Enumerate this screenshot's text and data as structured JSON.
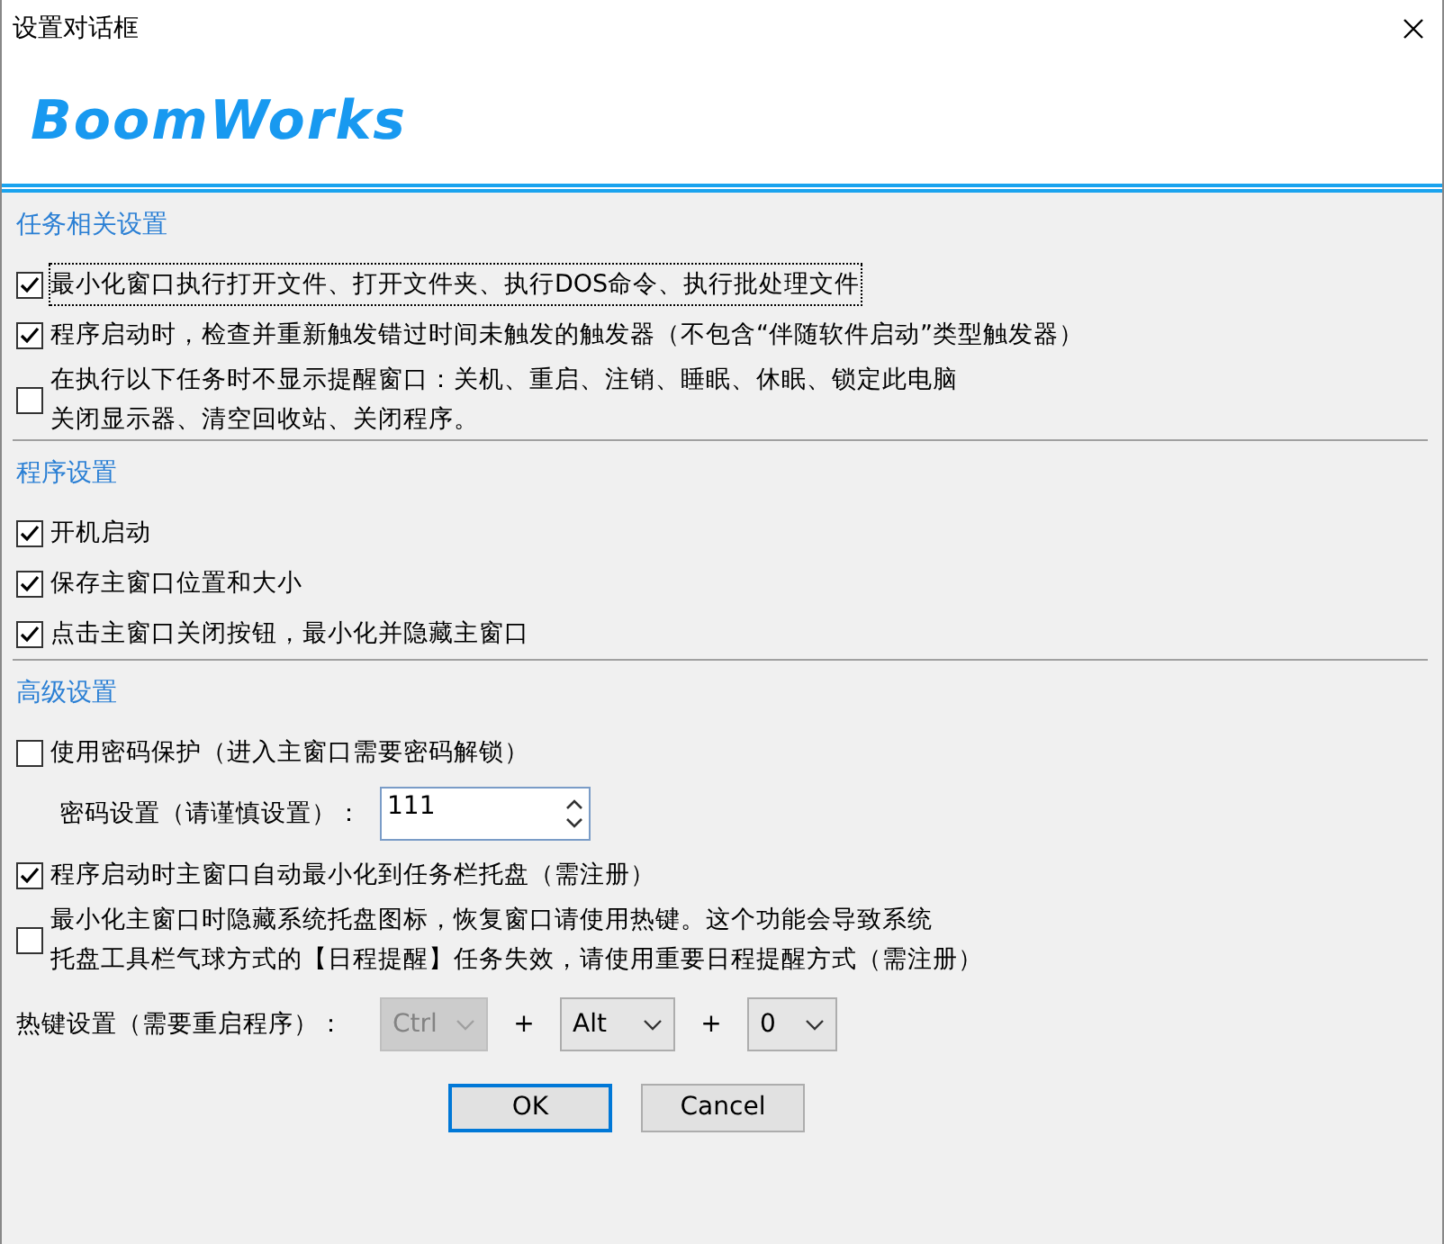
{
  "window": {
    "title": "设置对话框"
  },
  "logo": "BoomWorks",
  "sections": [
    {
      "heading": "任务相关设置",
      "items": [
        {
          "kind": "checkbox",
          "label": "最小化窗口执行打开文件、打开文件夹、执行DOS命令、执行批处理文件",
          "checked": true,
          "focused": true
        },
        {
          "kind": "checkbox",
          "label": "程序启动时，检查并重新触发错过时间未触发的触发器（不包含“伴随软件启动”类型触发器）",
          "checked": true,
          "focused": false
        },
        {
          "kind": "checkbox",
          "lines": [
            "在执行以下任务时不显示提醒窗口：关机、重启、注销、睡眠、休眠、锁定此电脑",
            "关闭显示器、清空回收站、关闭程序。"
          ],
          "checked": false,
          "focused": false
        }
      ]
    },
    {
      "heading": "程序设置",
      "items": [
        {
          "kind": "checkbox",
          "label": "开机启动",
          "checked": true,
          "focused": false
        },
        {
          "kind": "checkbox",
          "label": "保存主窗口位置和大小",
          "checked": true,
          "focused": false
        },
        {
          "kind": "checkbox",
          "label": "点击主窗口关闭按钮，最小化并隐藏主窗口",
          "checked": true,
          "focused": false
        }
      ]
    },
    {
      "heading": "高级设置",
      "items": [
        {
          "kind": "checkbox",
          "label": "使用密码保护（进入主窗口需要密码解锁）",
          "checked": false,
          "focused": false
        },
        {
          "kind": "spin",
          "label": "密码设置（请谨慎设置）：",
          "value": "111"
        },
        {
          "kind": "checkbox",
          "label": "程序启动时主窗口自动最小化到任务栏托盘（需注册）",
          "checked": true,
          "focused": false
        },
        {
          "kind": "checkbox",
          "lines": [
            "最小化主窗口时隐藏系统托盘图标，恢复窗口请使用热键。这个功能会导致系统",
            "托盘工具栏气球方式的【日程提醒】任务失效，请使用重要日程提醒方式（需注册）"
          ],
          "checked": false,
          "focused": false
        }
      ]
    }
  ],
  "hotkey": {
    "label": "热键设置（需要重启程序）：",
    "keys": [
      {
        "value": "Ctrl",
        "disabled": true
      },
      {
        "value": "Alt",
        "disabled": false
      },
      {
        "value": "0",
        "disabled": false
      }
    ],
    "joiners": [
      "+",
      "+"
    ]
  },
  "buttons": [
    {
      "label": "OK",
      "default": true
    },
    {
      "label": "Cancel",
      "default": false
    }
  ]
}
